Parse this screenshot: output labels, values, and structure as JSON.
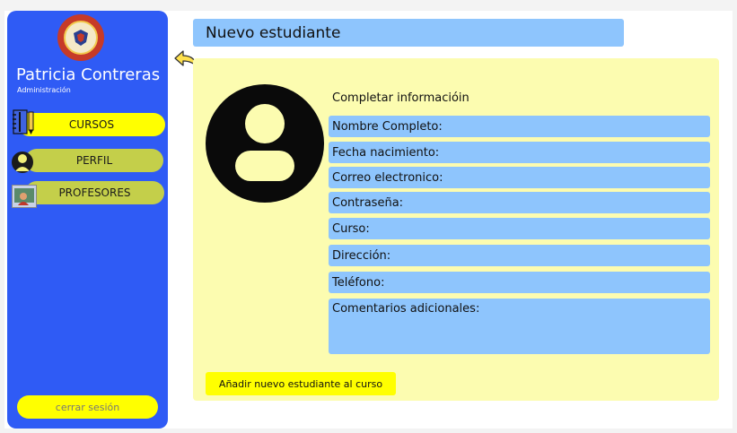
{
  "user": {
    "name": "Patricia Contreras",
    "role": "Administración"
  },
  "sidebar": {
    "items": [
      {
        "label": "CURSOS",
        "icon": "notebook-icon",
        "active": true
      },
      {
        "label": "PERFIL",
        "icon": "profile-icon"
      },
      {
        "label": "PROFESORES",
        "icon": "teacher-icon"
      }
    ],
    "logout_label": "cerrar sesión"
  },
  "header": {
    "title": "Nuevo estudiante"
  },
  "form": {
    "title": "Completar informacióin",
    "fields": [
      {
        "label": "Nombre Completo:"
      },
      {
        "label": "Fecha nacimiento:"
      },
      {
        "label": "Correo electronico:"
      },
      {
        "label": "Contraseña:"
      },
      {
        "label": "Curso:"
      },
      {
        "label": "Dirección:"
      },
      {
        "label": "Teléfono:"
      },
      {
        "label": "Comentarios adicionales:"
      }
    ],
    "submit_label": "Añadir nuevo estudiante al curso"
  },
  "colors": {
    "sidebar": "#2f5bf5",
    "active_nav": "#ffff00",
    "nav": "#c4cf4a",
    "field": "#8ec5fd",
    "panel": "#fcfcb0"
  }
}
